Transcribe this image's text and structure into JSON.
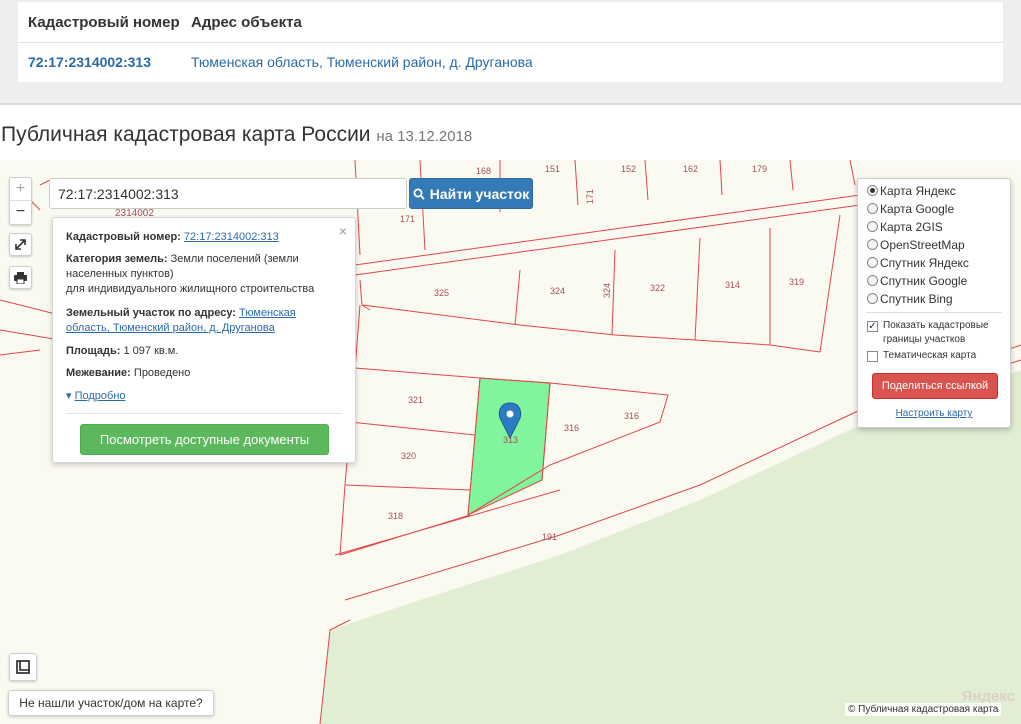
{
  "results": {
    "header_number": "Кадастровый номер",
    "header_address": "Адрес объекта",
    "row_number": "72:17:2314002:313",
    "row_address": "Тюменская область, Тюменский район, д. Друганова"
  },
  "title": {
    "text": "Публичная кадастровая карта России",
    "date": "на 13.12.2018"
  },
  "search": {
    "value": "72:17:2314002:313",
    "button_label": "Найти участок"
  },
  "zoom": {
    "in_label": "+",
    "out_label": "−"
  },
  "popup": {
    "close": "×",
    "number_label": "Кадастровый номер:",
    "number_value": "72:17:2314002:313",
    "category_label": "Категория земель:",
    "category_value_1": "Земли поселений (земли",
    "category_value_2": "населенных пунктов)",
    "category_value_3": "для индивидуального жилищного строительства",
    "address_label": "Земельный участок по адресу:",
    "address_value_1": "Тюменская",
    "address_value_2": "область, Тюменский район, д. Друганова",
    "area_label": "Площадь:",
    "area_value": "1 097 кв.м.",
    "survey_label": "Межевание:",
    "survey_value": "Проведено",
    "more_label": "Подробно",
    "docs_button": "Посмотреть доступные документы"
  },
  "layers": {
    "options": [
      {
        "label": "Карта Яндекс",
        "selected": true
      },
      {
        "label": "Карта Google",
        "selected": false
      },
      {
        "label": "Карта 2GIS",
        "selected": false
      },
      {
        "label": "OpenStreetMap",
        "selected": false
      },
      {
        "label": "Спутник Яндекс",
        "selected": false
      },
      {
        "label": "Спутник Google",
        "selected": false
      },
      {
        "label": "Спутник Bing",
        "selected": false
      }
    ],
    "show_borders_1": "Показать кадастровые",
    "show_borders_2": "границы участков",
    "show_borders_checked": true,
    "thematic": "Тематическая карта",
    "thematic_checked": false,
    "share_button": "Поделиться ссылкой",
    "tune_link": "Настроить карту"
  },
  "map": {
    "block_label": "2314002",
    "parcel_labels": [
      "168",
      "151",
      "171",
      "152",
      "162",
      "179",
      "171",
      "325",
      "324",
      "324",
      "322",
      "314",
      "319",
      "321",
      "313",
      "316",
      "316",
      "320",
      "318",
      "191"
    ],
    "selected_parcel_color": "#80f59b",
    "border_color": "#e0474c",
    "forest_color": "#e1eed4",
    "marker_color": "#2b7cc3"
  },
  "bottom": {
    "not_found_button": "Не нашли участок/дом на карте?",
    "yandex_logo": "Яндекс",
    "copyright": "© Публичная кадастровая карта"
  }
}
